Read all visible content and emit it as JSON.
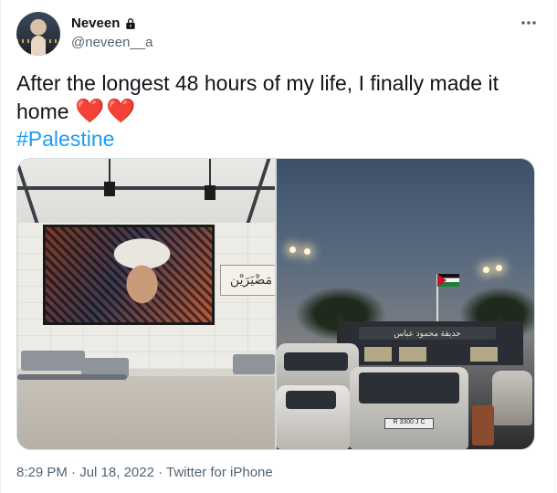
{
  "author": {
    "display_name": "Neveen",
    "handle": "@neveen__a",
    "protected": true
  },
  "tweet": {
    "text": "After the longest 48 hours of my life, I finally made it home",
    "emoji": "❤️❤️",
    "hashtag": "#Palestine"
  },
  "media": {
    "left_photo": {
      "calligraphy_text": "مَضْيَرَيْن"
    },
    "right_photo": {
      "sign_text": "حديقة محمود عباس",
      "plate_text": "R 3300 J C"
    }
  },
  "meta": {
    "time": "8:29 PM",
    "separator": " · ",
    "date": "Jul 18, 2022",
    "source": "Twitter for iPhone"
  },
  "colors": {
    "link": "#1d9bf0",
    "muted": "#536471",
    "heart": "#e0245e"
  },
  "icons": [
    "lock-icon",
    "more-horizontal-icon"
  ]
}
